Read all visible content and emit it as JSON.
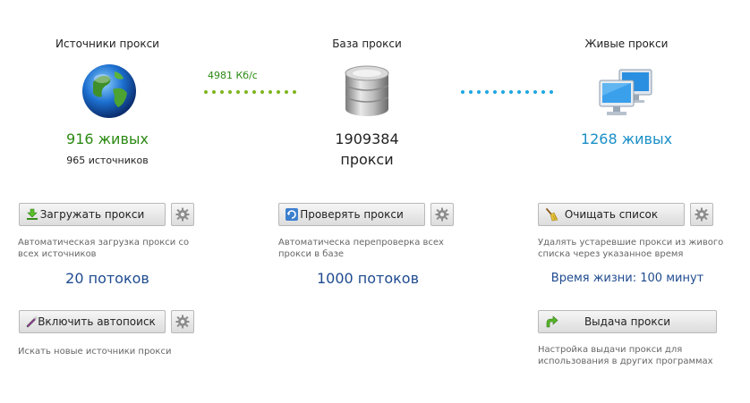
{
  "sources": {
    "title": "Источники прокси",
    "alive": "916 живых",
    "count": "965 источников"
  },
  "link_left": {
    "speed": "4981 Кб/с"
  },
  "base": {
    "title": "База прокси",
    "number": "1909384",
    "unit": "прокси"
  },
  "live": {
    "title": "Живые прокси",
    "alive": "1268 живых"
  },
  "load": {
    "button": "Загружать прокси",
    "desc": "Автоматическая загрузка прокси со всех источников",
    "threads": "20 потоков"
  },
  "autosearch": {
    "button": "Включить автопоиск",
    "desc": "Искать новые источники прокси"
  },
  "check": {
    "button": "Проверять прокси",
    "desc": "Автоматическа перепроверка всех прокси в базе",
    "threads": "1000 потоков"
  },
  "clean": {
    "button": "Очищать список",
    "desc": "Удалять устаревшие прокси из живого списка через указанное время",
    "lifetime": "Время жизни: 100 минут"
  },
  "output": {
    "button": "Выдача прокси",
    "desc": "Настройка выдачи прокси для использования в других программах"
  },
  "colors": {
    "green": "#2b8a13",
    "blue": "#1a8fc7",
    "navy": "#1f4b8f",
    "dots_green": "#7fb51e",
    "dots_blue": "#1fa6e0"
  }
}
